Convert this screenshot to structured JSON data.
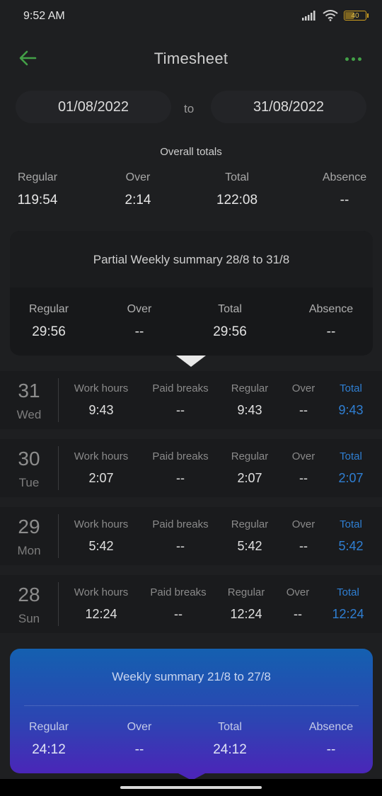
{
  "status_bar": {
    "time": "9:52 AM",
    "battery": "40"
  },
  "app_bar": {
    "title": "Timesheet",
    "back_icon": "arrow-left-icon",
    "more_icon": "more-dots-icon",
    "accent_color": "#43a047"
  },
  "date_range": {
    "from": "01/08/2022",
    "separator": "to",
    "to": "31/08/2022"
  },
  "overall": {
    "label": "Overall totals",
    "columns": [
      {
        "label": "Regular",
        "value": "119:54"
      },
      {
        "label": "Over",
        "value": "2:14"
      },
      {
        "label": "Total",
        "value": "122:08"
      },
      {
        "label": "Absence",
        "value": "--"
      }
    ]
  },
  "partial_summary": {
    "title": "Partial Weekly summary 28/8 to 31/8",
    "columns": [
      {
        "label": "Regular",
        "value": "29:56"
      },
      {
        "label": "Over",
        "value": "--"
      },
      {
        "label": "Total",
        "value": "29:56"
      },
      {
        "label": "Absence",
        "value": "--"
      }
    ]
  },
  "day_headers": {
    "work": "Work hours",
    "breaks": "Paid breaks",
    "regular": "Regular",
    "over": "Over",
    "total": "Total"
  },
  "days": [
    {
      "num": "31",
      "name": "Wed",
      "work": "9:43",
      "breaks": "--",
      "regular": "9:43",
      "over": "--",
      "total": "9:43"
    },
    {
      "num": "30",
      "name": "Tue",
      "work": "2:07",
      "breaks": "--",
      "regular": "2:07",
      "over": "--",
      "total": "2:07"
    },
    {
      "num": "29",
      "name": "Mon",
      "work": "5:42",
      "breaks": "--",
      "regular": "5:42",
      "over": "--",
      "total": "5:42"
    },
    {
      "num": "28",
      "name": "Sun",
      "work": "12:24",
      "breaks": "--",
      "regular": "12:24",
      "over": "--",
      "total": "12:24"
    }
  ],
  "weekly_summary": {
    "title": "Weekly summary 21/8 to 27/8",
    "columns": [
      {
        "label": "Regular",
        "value": "24:12"
      },
      {
        "label": "Over",
        "value": "--"
      },
      {
        "label": "Total",
        "value": "24:12"
      },
      {
        "label": "Absence",
        "value": "--"
      }
    ]
  },
  "colors": {
    "total_blue": "#2f7fd3",
    "card_gradient_top": "#1460b0",
    "card_gradient_bottom": "#4a26b8"
  }
}
